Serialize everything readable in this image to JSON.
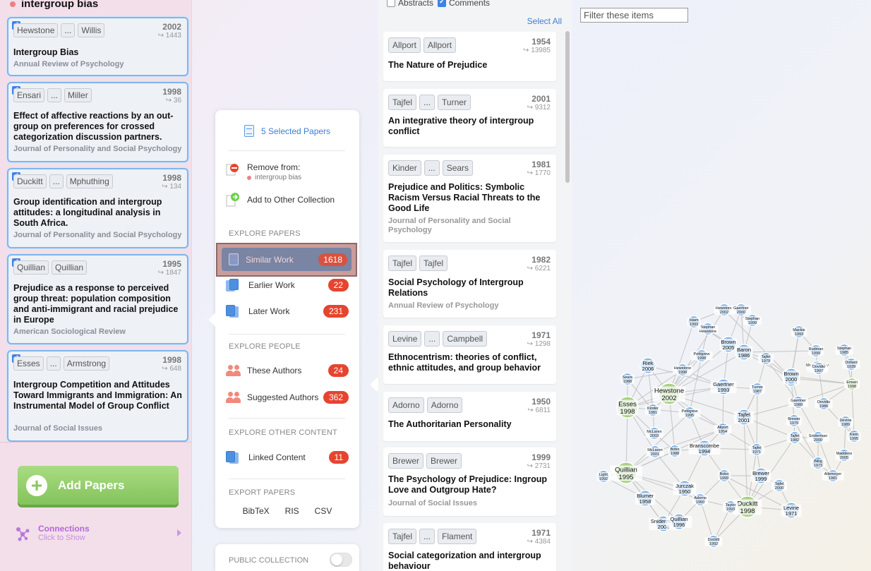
{
  "collection": {
    "title": "intergroup bias"
  },
  "selected_papers": [
    {
      "authors": [
        "Hewstone",
        "...",
        "Willis"
      ],
      "year": "2002",
      "cites": "↪ 1443",
      "title": "Intergroup Bias",
      "journal": "Annual Review of Psychology"
    },
    {
      "authors": [
        "Ensari",
        "...",
        "Miller"
      ],
      "year": "1998",
      "cites": "↪ 36",
      "title": "Effect of affective reactions by an out-group on preferences for crossed categorization discussion partners.",
      "journal": "Journal of Personality and Social Psychology"
    },
    {
      "authors": [
        "Duckitt",
        "...",
        "Mphuthing"
      ],
      "year": "1998",
      "cites": "↪ 134",
      "title": "Group identification and intergroup attitudes: a longitudinal analysis in South Africa.",
      "journal": "Journal of Personality and Social Psychology"
    },
    {
      "authors": [
        "Quillian",
        "Quillian"
      ],
      "year": "1995",
      "cites": "↪ 1847",
      "title": "Prejudice as a response to perceived group threat: population composition and anti-immigrant and racial prejudice in Europe",
      "journal": "American Sociological Review"
    },
    {
      "authors": [
        "Esses",
        "...",
        "Armstrong"
      ],
      "year": "1998",
      "cites": "↪ 648",
      "title": "Intergroup Competition and Attitudes Toward Immigrants and Immigration: An Instrumental Model of Group Conflict",
      "journal": "Journal of Social Issues"
    }
  ],
  "add_papers_label": "Add Papers",
  "connections": {
    "title": "Connections",
    "subtitle": "Click to Show"
  },
  "menu": {
    "selected_label": "5 Selected Papers",
    "remove_label": "Remove from:",
    "remove_collection": "intergroup bias",
    "add_other_label": "Add to Other Collection",
    "explore_papers_header": "EXPLORE PAPERS",
    "similar_label": "Similar Work",
    "similar_count": "1618",
    "earlier_label": "Earlier Work",
    "earlier_count": "22",
    "later_label": "Later Work",
    "later_count": "231",
    "explore_people_header": "EXPLORE PEOPLE",
    "these_authors_label": "These Authors",
    "these_authors_count": "24",
    "suggested_authors_label": "Suggested Authors",
    "suggested_authors_count": "362",
    "explore_other_header": "EXPLORE OTHER CONTENT",
    "linked_label": "Linked Content",
    "linked_count": "11",
    "export_header": "EXPORT PAPERS",
    "export_bibtex": "BibTeX",
    "export_ris": "RIS",
    "export_csv": "CSV",
    "public_label": "PUBLIC COLLECTION"
  },
  "results_options": {
    "abstracts_label": "Abstracts",
    "comments_label": "Comments",
    "select_all": "Select All"
  },
  "results": [
    {
      "authors": [
        "Allport",
        "Allport"
      ],
      "year": "1954",
      "cites": "↪ 13985",
      "title": "The Nature of Prejudice",
      "journal": ""
    },
    {
      "authors": [
        "Tajfel",
        "...",
        "Turner"
      ],
      "year": "2001",
      "cites": "↪ 9312",
      "title": "An integrative theory of intergroup conflict",
      "journal": ""
    },
    {
      "authors": [
        "Kinder",
        "...",
        "Sears"
      ],
      "year": "1981",
      "cites": "↪ 1770",
      "title": "Prejudice and Politics: Symbolic Racism Versus Racial Threats to the Good Life",
      "journal": "Journal of Personality and Social Psychology"
    },
    {
      "authors": [
        "Tajfel",
        "Tajfel"
      ],
      "year": "1982",
      "cites": "↪ 6221",
      "title": "Social Psychology of Intergroup Relations",
      "journal": "Annual Review of Psychology"
    },
    {
      "authors": [
        "Levine",
        "...",
        "Campbell"
      ],
      "year": "1971",
      "cites": "↪ 1298",
      "title": "Ethnocentrism: theories of conflict, ethnic attitudes, and group behavior",
      "journal": ""
    },
    {
      "authors": [
        "Adorno",
        "Adorno"
      ],
      "year": "1950",
      "cites": "↪ 6811",
      "title": "The Authoritarian Personality",
      "journal": ""
    },
    {
      "authors": [
        "Brewer",
        "Brewer"
      ],
      "year": "1999",
      "cites": "↪ 2731",
      "title": "The Psychology of Prejudice: Ingroup Love and Outgroup Hate?",
      "journal": "Journal of Social Issues"
    },
    {
      "authors": [
        "Tajfel",
        "...",
        "Flament"
      ],
      "year": "1971",
      "cites": "↪ 4384",
      "title": "Social categorization and intergroup behaviour",
      "journal": ""
    }
  ],
  "filter_placeholder": "Filter these items",
  "graph": {
    "colors": {
      "node": "#5b9fe3",
      "node_selected": "#9ccc71",
      "edge": "#bdbdbd"
    },
    "nodes": [
      {
        "label": "Hewstone\n2002",
        "sel": true,
        "big": true
      },
      {
        "label": "Esses\n1998",
        "sel": true,
        "big": true
      },
      {
        "label": "Quillian\n1995",
        "sel": true,
        "big": true
      },
      {
        "label": "Duckitt\n1998",
        "sel": true,
        "big": true
      },
      {
        "label": "Ensari\n1998",
        "sel": true,
        "big": false
      },
      {
        "label": "Islam\n1993"
      },
      {
        "label": "Hewstone\n2002"
      },
      {
        "label": "Gaertner\n2000"
      },
      {
        "label": "Stephan\n1999"
      },
      {
        "label": "Stephan\nHewstone"
      },
      {
        "label": "Brown\n2005"
      },
      {
        "label": "Baron\n1986"
      },
      {
        "label": "Mackie\n1993"
      },
      {
        "label": "Stephan\n1985"
      },
      {
        "label": "Pettigrew\n1998"
      },
      {
        "label": "Rudman\n1999"
      },
      {
        "label": "Brown\n1986"
      },
      {
        "label": "Hewstone\n1998"
      },
      {
        "label": "Riek\n2006"
      },
      {
        "label": "Tajfel\n1979"
      },
      {
        "label": "Mummendey\n2003"
      },
      {
        "label": "Dovidio\n1997"
      },
      {
        "label": "Dollard\n1939"
      },
      {
        "label": "Brown\n2000"
      },
      {
        "label": "Sears\n1988"
      },
      {
        "label": "Gaertner\n1993"
      },
      {
        "label": "Turner\n1987"
      },
      {
        "label": "Gaertner\n1989"
      },
      {
        "label": "Dovidio\n1986"
      },
      {
        "label": "Kinder\n1981"
      },
      {
        "label": "Pettigrew\n1995"
      },
      {
        "label": "Tajfel\n2001"
      },
      {
        "label": "Devine\n1989"
      },
      {
        "label": "Allport\n1954"
      },
      {
        "label": "McLaren\n2003"
      },
      {
        "label": "Tajfel\n1971"
      },
      {
        "label": "Tajfel\n1982"
      },
      {
        "label": "Sniderman\n2000"
      },
      {
        "label": "Klein\n1995"
      },
      {
        "label": "McLaren\n2001"
      },
      {
        "label": "Bobo\n1988"
      },
      {
        "label": "Branscombe\n1994"
      },
      {
        "label": "Brewer\n1979"
      },
      {
        "label": "Billig\n1973"
      },
      {
        "label": "Maddens\n2005"
      },
      {
        "label": "Light\n1992"
      },
      {
        "label": "Bobo\n1999"
      },
      {
        "label": "Brewer\n1999"
      },
      {
        "label": "Allemeyer\n1981"
      },
      {
        "label": "Jurczak\n1950"
      },
      {
        "label": "Tajfel\n2000"
      },
      {
        "label": "Blumer\n1958"
      },
      {
        "label": "Adorno\n1950"
      },
      {
        "label": "Levine\n1971"
      },
      {
        "label": "Taylor\n1993"
      },
      {
        "label": "Sniderman\n2004"
      },
      {
        "label": "Quillian\n1996"
      },
      {
        "label": "Duckitt\n1992"
      }
    ]
  }
}
